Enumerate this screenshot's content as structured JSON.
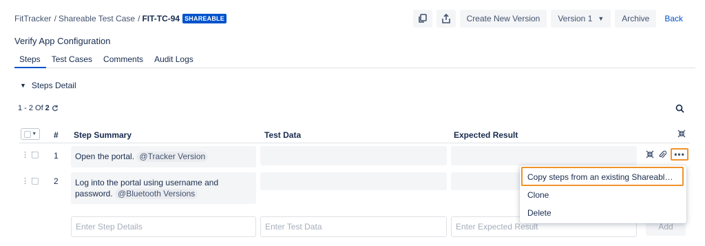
{
  "breadcrumb": {
    "project": "FitTracker",
    "sep1": "/",
    "folder": "Shareable Test Case",
    "sep2": "/",
    "key": "FIT-TC-94",
    "badge": "SHAREABLE"
  },
  "toolbar": {
    "copy_icon": "copy-icon",
    "share_icon": "share-icon",
    "create_version": "Create New Version",
    "version": "Version 1",
    "archive": "Archive",
    "back": "Back"
  },
  "page_title": "Verify App Configuration",
  "tabs": [
    {
      "label": "Steps",
      "active": true
    },
    {
      "label": "Test Cases",
      "active": false
    },
    {
      "label": "Comments",
      "active": false
    },
    {
      "label": "Audit Logs",
      "active": false
    }
  ],
  "section": {
    "label": "Steps Detail"
  },
  "pager": {
    "range": "1 - 2",
    "of": "Of",
    "total": "2"
  },
  "table": {
    "headers": {
      "num": "#",
      "summary": "Step Summary",
      "data": "Test Data",
      "result": "Expected Result"
    },
    "rows": [
      {
        "num": "1",
        "summary": "Open the portal.",
        "mention": "@Tracker Version"
      },
      {
        "num": "2",
        "summary_line1": "Log into the portal using username and",
        "summary_line2": "password.",
        "mention": "@Bluetooth Versions"
      }
    ],
    "new_row": {
      "step_placeholder": "Enter Step Details",
      "data_placeholder": "Enter Test Data",
      "result_placeholder": "Enter Expected Result",
      "add_label": "Add"
    }
  },
  "menu": {
    "items": [
      "Copy steps from an existing Shareable T...",
      "Clone",
      "Delete"
    ]
  },
  "colors": {
    "accent": "#0052cc",
    "highlight": "#f0912b",
    "cell_bg": "#f4f5f7"
  }
}
